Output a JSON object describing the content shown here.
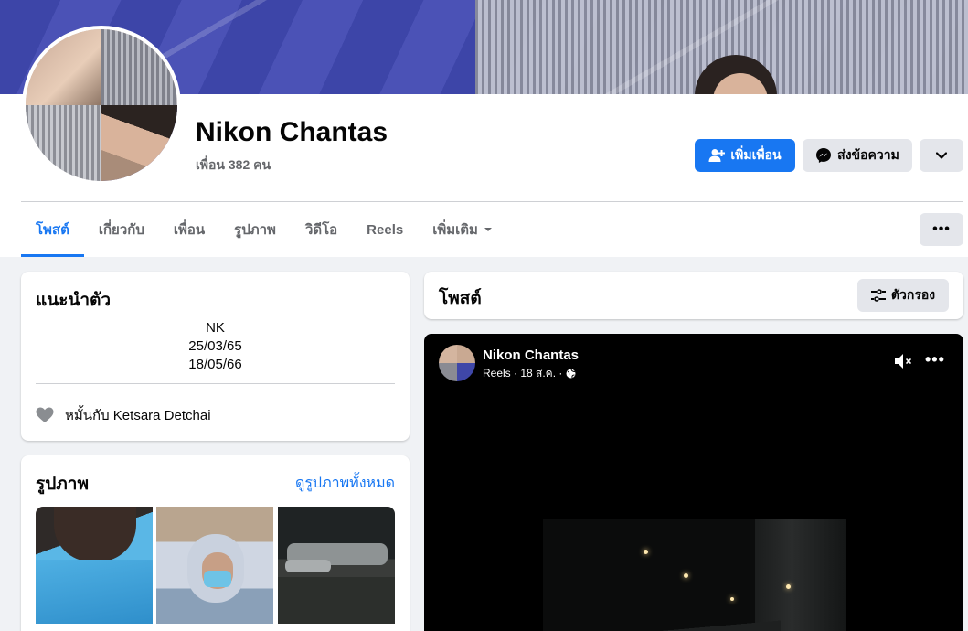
{
  "profile": {
    "name": "Nikon Chantas",
    "friends_count": "เพื่อน 382 คน"
  },
  "actions": {
    "add_friend": "เพิ่มเพื่อน",
    "message": "ส่งข้อความ"
  },
  "tabs": [
    {
      "label": "โพสต์",
      "active": true
    },
    {
      "label": "เกี่ยวกับ"
    },
    {
      "label": "เพื่อน"
    },
    {
      "label": "รูปภาพ"
    },
    {
      "label": "วิดีโอ"
    },
    {
      "label": "Reels"
    },
    {
      "label": "เพิ่มเติม"
    }
  ],
  "intro": {
    "title": "แนะนำตัว",
    "bio_lines": [
      "NK",
      "25/03/65",
      "18/05/66"
    ],
    "relationship": "หมั้นกับ Ketsara Detchai"
  },
  "photos": {
    "title": "รูปภาพ",
    "see_all": "ดูรูปภาพทั้งหมด"
  },
  "posts": {
    "title": "โพสต์",
    "filter_label": "ตัวกรอง"
  },
  "reel_post": {
    "author": "Nikon Chantas",
    "meta": "Reels · 18 ส.ค. ·"
  },
  "colors": {
    "accent": "#1877f2",
    "background": "#f0f2f5",
    "secondary_button": "#e4e6eb"
  }
}
